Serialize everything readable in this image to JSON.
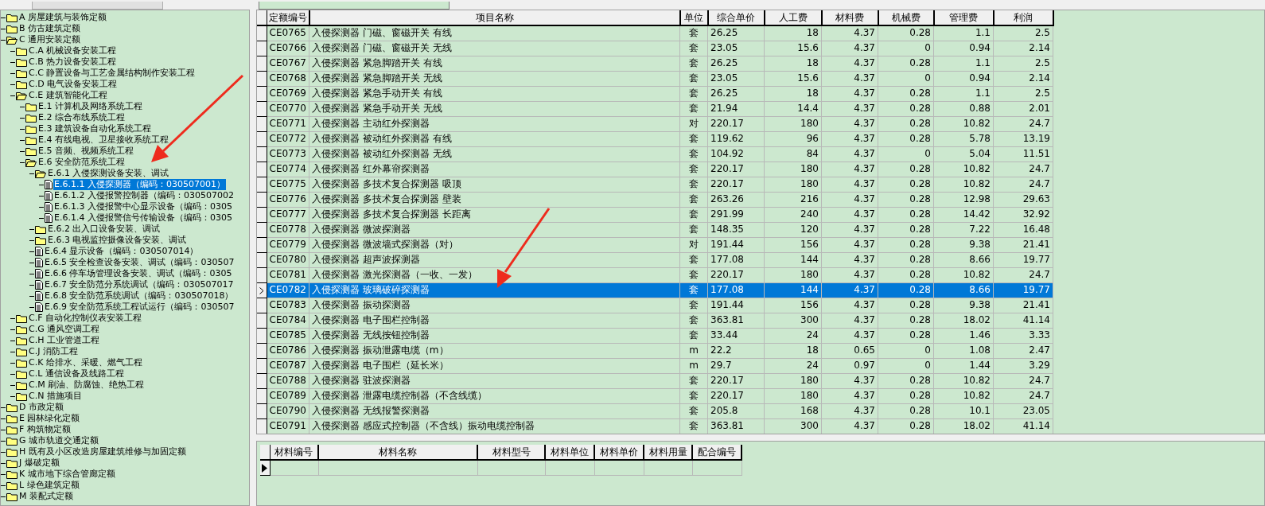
{
  "tree": [
    {
      "kind": "folder",
      "label": "A 房屋建筑与装饰定额",
      "expanded": false,
      "selected": false
    },
    {
      "kind": "folder",
      "label": "B 仿古建筑定额",
      "expanded": false,
      "selected": false
    },
    {
      "kind": "folder",
      "label": "C 通用安装定额",
      "expanded": true,
      "selected": false,
      "children": [
        {
          "kind": "folder",
          "label": "C.A 机械设备安装工程",
          "expanded": false,
          "selected": false
        },
        {
          "kind": "folder",
          "label": "C.B 热力设备安装工程",
          "expanded": false,
          "selected": false
        },
        {
          "kind": "folder",
          "label": "C.C 静置设备与工艺金属结构制作安装工程",
          "expanded": false,
          "selected": false
        },
        {
          "kind": "folder",
          "label": "C.D 电气设备安装工程",
          "expanded": false,
          "selected": false
        },
        {
          "kind": "folder",
          "label": "C.E 建筑智能化工程",
          "expanded": true,
          "selected": false,
          "children": [
            {
              "kind": "folder",
              "label": "E.1 计算机及网络系统工程",
              "expanded": false,
              "selected": false
            },
            {
              "kind": "folder",
              "label": "E.2 综合布线系统工程",
              "expanded": false,
              "selected": false
            },
            {
              "kind": "folder",
              "label": "E.3 建筑设备自动化系统工程",
              "expanded": false,
              "selected": false
            },
            {
              "kind": "folder",
              "label": "E.4 有线电视、卫星接收系统工程",
              "expanded": false,
              "selected": false
            },
            {
              "kind": "folder",
              "label": "E.5 音频、视频系统工程",
              "expanded": false,
              "selected": false
            },
            {
              "kind": "folder",
              "label": "E.6 安全防范系统工程",
              "expanded": true,
              "selected": false,
              "children": [
                {
                  "kind": "folder",
                  "label": "E.6.1 入侵探测设备安装、调试",
                  "expanded": true,
                  "selected": false,
                  "children": [
                    {
                      "kind": "doc",
                      "label": "E.6.1.1 入侵探测器（编码：030507001）",
                      "selected": true
                    },
                    {
                      "kind": "doc",
                      "label": "E.6.1.2 入侵报警控制器（编码：030507002",
                      "selected": false
                    },
                    {
                      "kind": "doc",
                      "label": "E.6.1.3 入侵报警中心显示设备（编码：0305",
                      "selected": false
                    },
                    {
                      "kind": "doc",
                      "label": "E.6.1.4 入侵报警信号传输设备（编码：0305",
                      "selected": false
                    }
                  ]
                },
                {
                  "kind": "folder",
                  "label": "E.6.2 出入口设备安装、调试",
                  "expanded": false,
                  "selected": false
                },
                {
                  "kind": "folder",
                  "label": "E.6.3 电视监控摄像设备安装、调试",
                  "expanded": false,
                  "selected": false
                },
                {
                  "kind": "doc",
                  "label": "E.6.4 显示设备（编码：030507014）",
                  "selected": false
                },
                {
                  "kind": "doc",
                  "label": "E.6.5 安全检查设备安装、调试（编码：030507",
                  "selected": false
                },
                {
                  "kind": "doc",
                  "label": "E.6.6 停车场管理设备安装、调试（编码：0305",
                  "selected": false
                },
                {
                  "kind": "doc",
                  "label": "E.6.7 安全防范分系统调试（编码：030507017",
                  "selected": false
                },
                {
                  "kind": "doc",
                  "label": "E.6.8 安全防范系统调试（编码：030507018）",
                  "selected": false
                },
                {
                  "kind": "doc",
                  "label": "E.6.9 安全防范系统工程试运行（编码：030507",
                  "selected": false
                }
              ]
            }
          ]
        },
        {
          "kind": "folder",
          "label": "C.F 自动化控制仪表安装工程",
          "expanded": false,
          "selected": false
        },
        {
          "kind": "folder",
          "label": "C.G 通风空调工程",
          "expanded": false,
          "selected": false
        },
        {
          "kind": "folder",
          "label": "C.H 工业管道工程",
          "expanded": false,
          "selected": false
        },
        {
          "kind": "folder",
          "label": "C.J 消防工程",
          "expanded": false,
          "selected": false
        },
        {
          "kind": "folder",
          "label": "C.K 给排水、采暖、燃气工程",
          "expanded": false,
          "selected": false
        },
        {
          "kind": "folder",
          "label": "C.L 通信设备及线路工程",
          "expanded": false,
          "selected": false
        },
        {
          "kind": "folder",
          "label": "C.M 刷油、防腐蚀、绝热工程",
          "expanded": false,
          "selected": false
        },
        {
          "kind": "folder",
          "label": "C.N 措施项目",
          "expanded": false,
          "selected": false
        }
      ]
    },
    {
      "kind": "folder",
      "label": "D 市政定额",
      "expanded": false,
      "selected": false
    },
    {
      "kind": "folder",
      "label": "E 园林绿化定额",
      "expanded": false,
      "selected": false
    },
    {
      "kind": "folder",
      "label": "F 构筑物定额",
      "expanded": false,
      "selected": false
    },
    {
      "kind": "folder",
      "label": "G 城市轨道交通定额",
      "expanded": false,
      "selected": false
    },
    {
      "kind": "folder",
      "label": "H 既有及小区改造房屋建筑维修与加固定额",
      "expanded": false,
      "selected": false
    },
    {
      "kind": "folder",
      "label": "J 爆破定额",
      "expanded": false,
      "selected": false
    },
    {
      "kind": "folder",
      "label": "K 城市地下综合管廊定额",
      "expanded": false,
      "selected": false
    },
    {
      "kind": "folder",
      "label": "L 绿色建筑定额",
      "expanded": false,
      "selected": false
    },
    {
      "kind": "folder",
      "label": "M 装配式定额",
      "expanded": false,
      "selected": false
    }
  ],
  "quota_table": {
    "columns": [
      "定额编号",
      "项目名称",
      "单位",
      "综合单价",
      "人工费",
      "材料费",
      "机械费",
      "管理费",
      "利润"
    ],
    "rows": [
      {
        "selected": false,
        "cells": [
          "CE0765",
          "入侵探测器 门磁、窗磁开关 有线",
          "套",
          "26.25",
          "18",
          "4.37",
          "0.28",
          "1.1",
          "2.5"
        ]
      },
      {
        "selected": false,
        "cells": [
          "CE0766",
          "入侵探测器 门磁、窗磁开关 无线",
          "套",
          "23.05",
          "15.6",
          "4.37",
          "0",
          "0.94",
          "2.14"
        ]
      },
      {
        "selected": false,
        "cells": [
          "CE0767",
          "入侵探测器 紧急脚踏开关 有线",
          "套",
          "26.25",
          "18",
          "4.37",
          "0.28",
          "1.1",
          "2.5"
        ]
      },
      {
        "selected": false,
        "cells": [
          "CE0768",
          "入侵探测器 紧急脚踏开关 无线",
          "套",
          "23.05",
          "15.6",
          "4.37",
          "0",
          "0.94",
          "2.14"
        ]
      },
      {
        "selected": false,
        "cells": [
          "CE0769",
          "入侵探测器 紧急手动开关 有线",
          "套",
          "26.25",
          "18",
          "4.37",
          "0.28",
          "1.1",
          "2.5"
        ]
      },
      {
        "selected": false,
        "cells": [
          "CE0770",
          "入侵探测器 紧急手动开关 无线",
          "套",
          "21.94",
          "14.4",
          "4.37",
          "0.28",
          "0.88",
          "2.01"
        ]
      },
      {
        "selected": false,
        "cells": [
          "CE0771",
          "入侵探测器 主动红外探测器",
          "对",
          "220.17",
          "180",
          "4.37",
          "0.28",
          "10.82",
          "24.7"
        ]
      },
      {
        "selected": false,
        "cells": [
          "CE0772",
          "入侵探测器 被动红外探测器 有线",
          "套",
          "119.62",
          "96",
          "4.37",
          "0.28",
          "5.78",
          "13.19"
        ]
      },
      {
        "selected": false,
        "cells": [
          "CE0773",
          "入侵探测器 被动红外探测器 无线",
          "套",
          "104.92",
          "84",
          "4.37",
          "0",
          "5.04",
          "11.51"
        ]
      },
      {
        "selected": false,
        "cells": [
          "CE0774",
          "入侵探测器 红外幕帘探测器",
          "套",
          "220.17",
          "180",
          "4.37",
          "0.28",
          "10.82",
          "24.7"
        ]
      },
      {
        "selected": false,
        "cells": [
          "CE0775",
          "入侵探测器 多技术复合探测器 吸顶",
          "套",
          "220.17",
          "180",
          "4.37",
          "0.28",
          "10.82",
          "24.7"
        ]
      },
      {
        "selected": false,
        "cells": [
          "CE0776",
          "入侵探测器 多技术复合探测器 壁装",
          "套",
          "263.26",
          "216",
          "4.37",
          "0.28",
          "12.98",
          "29.63"
        ]
      },
      {
        "selected": false,
        "cells": [
          "CE0777",
          "入侵探测器 多技术复合探测器 长距离",
          "套",
          "291.99",
          "240",
          "4.37",
          "0.28",
          "14.42",
          "32.92"
        ]
      },
      {
        "selected": false,
        "cells": [
          "CE0778",
          "入侵探测器 微波探测器",
          "套",
          "148.35",
          "120",
          "4.37",
          "0.28",
          "7.22",
          "16.48"
        ]
      },
      {
        "selected": false,
        "cells": [
          "CE0779",
          "入侵探测器 微波墙式探测器（对）",
          "对",
          "191.44",
          "156",
          "4.37",
          "0.28",
          "9.38",
          "21.41"
        ]
      },
      {
        "selected": false,
        "cells": [
          "CE0780",
          "入侵探测器 超声波探测器",
          "套",
          "177.08",
          "144",
          "4.37",
          "0.28",
          "8.66",
          "19.77"
        ]
      },
      {
        "selected": false,
        "cells": [
          "CE0781",
          "入侵探测器 激光探测器（一收、一发）",
          "套",
          "220.17",
          "180",
          "4.37",
          "0.28",
          "10.82",
          "24.7"
        ]
      },
      {
        "selected": true,
        "cells": [
          "CE0782",
          "入侵探测器 玻璃破碎探测器",
          "套",
          "177.08",
          "144",
          "4.37",
          "0.28",
          "8.66",
          "19.77"
        ]
      },
      {
        "selected": false,
        "cells": [
          "CE0783",
          "入侵探测器 振动探测器",
          "套",
          "191.44",
          "156",
          "4.37",
          "0.28",
          "9.38",
          "21.41"
        ]
      },
      {
        "selected": false,
        "cells": [
          "CE0784",
          "入侵探测器 电子围栏控制器",
          "套",
          "363.81",
          "300",
          "4.37",
          "0.28",
          "18.02",
          "41.14"
        ]
      },
      {
        "selected": false,
        "cells": [
          "CE0785",
          "入侵探测器 无线按钮控制器",
          "套",
          "33.44",
          "24",
          "4.37",
          "0.28",
          "1.46",
          "3.33"
        ]
      },
      {
        "selected": false,
        "cells": [
          "CE0786",
          "入侵探测器 振动泄露电缆（m）",
          "m",
          "22.2",
          "18",
          "0.65",
          "0",
          "1.08",
          "2.47"
        ]
      },
      {
        "selected": false,
        "cells": [
          "CE0787",
          "入侵探测器 电子围栏（延长米）",
          "m",
          "29.7",
          "24",
          "0.97",
          "0",
          "1.44",
          "3.29"
        ]
      },
      {
        "selected": false,
        "cells": [
          "CE0788",
          "入侵探测器 驻波探测器",
          "套",
          "220.17",
          "180",
          "4.37",
          "0.28",
          "10.82",
          "24.7"
        ]
      },
      {
        "selected": false,
        "cells": [
          "CE0789",
          "入侵探测器 泄露电缆控制器（不含线缆）",
          "套",
          "220.17",
          "180",
          "4.37",
          "0.28",
          "10.82",
          "24.7"
        ]
      },
      {
        "selected": false,
        "cells": [
          "CE0790",
          "入侵探测器 无线报警探测器",
          "套",
          "205.8",
          "168",
          "4.37",
          "0.28",
          "10.1",
          "23.05"
        ]
      },
      {
        "selected": false,
        "cells": [
          "CE0791",
          "入侵探测器 感应式控制器（不含线）振动电缆控制器",
          "套",
          "363.81",
          "300",
          "4.37",
          "0.28",
          "18.02",
          "41.14"
        ]
      }
    ]
  },
  "material_table": {
    "columns": [
      "材料编号",
      "材料名称",
      "材料型号",
      "材料单位",
      "材料单价",
      "材料用量",
      "配合编号"
    ]
  }
}
